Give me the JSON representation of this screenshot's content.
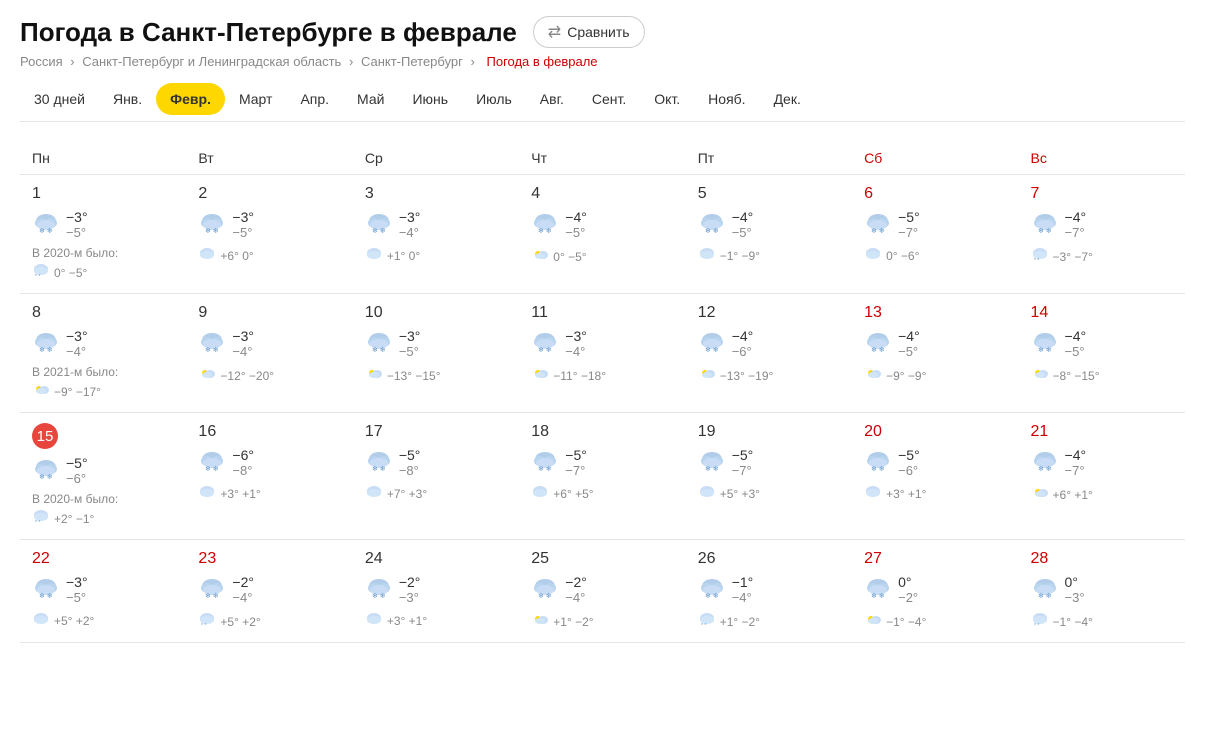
{
  "header": {
    "title": "Погода в Санкт-Петербурге в феврале",
    "compare_label": "Сравнить"
  },
  "breadcrumb": {
    "items": [
      "Россия",
      "Санкт-Петербург и Ленинградская область",
      "Санкт-Петербург"
    ],
    "current": "Погода в феврале"
  },
  "month_tabs": [
    {
      "label": "30 дней",
      "active": false
    },
    {
      "label": "Янв.",
      "active": false
    },
    {
      "label": "Февр.",
      "active": true
    },
    {
      "label": "Март",
      "active": false
    },
    {
      "label": "Апр.",
      "active": false
    },
    {
      "label": "Май",
      "active": false
    },
    {
      "label": "Июнь",
      "active": false
    },
    {
      "label": "Июль",
      "active": false
    },
    {
      "label": "Авг.",
      "active": false
    },
    {
      "label": "Сент.",
      "active": false
    },
    {
      "label": "Окт.",
      "active": false
    },
    {
      "label": "Нояб.",
      "active": false
    },
    {
      "label": "Дек.",
      "active": false
    }
  ],
  "weekdays": [
    {
      "label": "Пн",
      "weekend": false
    },
    {
      "label": "Вт",
      "weekend": false
    },
    {
      "label": "Ср",
      "weekend": false
    },
    {
      "label": "Чт",
      "weekend": false
    },
    {
      "label": "Пт",
      "weekend": false
    },
    {
      "label": "Сб",
      "weekend": true
    },
    {
      "label": "Вс",
      "weekend": true
    }
  ],
  "weeks": [
    {
      "days": [
        {
          "num": "1",
          "weekend": false,
          "today": false,
          "icon": "❄☁",
          "hi": "−3°",
          "lo": "−5°",
          "hist_label": "В 2020-м было:",
          "hist_icon": "☁❄",
          "hist_temps": "0° −5°"
        },
        {
          "num": "2",
          "weekend": false,
          "today": false,
          "icon": "❄☁",
          "hi": "−3°",
          "lo": "−5°",
          "hist_icon": "☁",
          "hist_temps": "+6° 0°"
        },
        {
          "num": "3",
          "weekend": false,
          "today": false,
          "icon": "❄☁",
          "hi": "−3°",
          "lo": "−4°",
          "hist_icon": "☁",
          "hist_temps": "+1° 0°"
        },
        {
          "num": "4",
          "weekend": false,
          "today": false,
          "icon": "❄☁",
          "hi": "−4°",
          "lo": "−5°",
          "hist_icon": "☀☁",
          "hist_temps": "0° −5°"
        },
        {
          "num": "5",
          "weekend": false,
          "today": false,
          "icon": "❄☁",
          "hi": "−4°",
          "lo": "−5°",
          "hist_icon": "☁",
          "hist_temps": "−1° −9°"
        },
        {
          "num": "6",
          "weekend": true,
          "today": false,
          "icon": "❄☁",
          "hi": "−5°",
          "lo": "−7°",
          "hist_icon": "☁",
          "hist_temps": "0° −6°"
        },
        {
          "num": "7",
          "weekend": true,
          "today": false,
          "icon": "❄☁",
          "hi": "−4°",
          "lo": "−7°",
          "hist_icon": "☁❄",
          "hist_temps": "−3° −7°"
        }
      ]
    },
    {
      "days": [
        {
          "num": "8",
          "weekend": false,
          "today": false,
          "icon": "❄☁",
          "hi": "−3°",
          "lo": "−4°",
          "hist_label": "В 2021-м было:",
          "hist_icon": "☀",
          "hist_temps": "−9° −17°"
        },
        {
          "num": "9",
          "weekend": false,
          "today": false,
          "icon": "❄☁",
          "hi": "−3°",
          "lo": "−4°",
          "hist_icon": "☀☁",
          "hist_temps": "−12° −20°"
        },
        {
          "num": "10",
          "weekend": false,
          "today": false,
          "icon": "❄☁",
          "hi": "−3°",
          "lo": "−5°",
          "hist_icon": "☀☁",
          "hist_temps": "−13° −15°"
        },
        {
          "num": "11",
          "weekend": false,
          "today": false,
          "icon": "❄☁",
          "hi": "−3°",
          "lo": "−4°",
          "hist_icon": "☀☁",
          "hist_temps": "−11° −18°"
        },
        {
          "num": "12",
          "weekend": false,
          "today": false,
          "icon": "❄☁",
          "hi": "−4°",
          "lo": "−6°",
          "hist_icon": "☀☁❄",
          "hist_temps": "−13° −19°"
        },
        {
          "num": "13",
          "weekend": true,
          "today": false,
          "icon": "❄☁",
          "hi": "−4°",
          "lo": "−5°",
          "hist_icon": "☀☁",
          "hist_temps": "−9° −9°"
        },
        {
          "num": "14",
          "weekend": true,
          "today": false,
          "icon": "❄☁",
          "hi": "−4°",
          "lo": "−5°",
          "hist_icon": "☀☁",
          "hist_temps": "−8° −15°"
        }
      ]
    },
    {
      "days": [
        {
          "num": "15",
          "weekend": false,
          "today": true,
          "icon": "❄☁",
          "hi": "−5°",
          "lo": "−6°",
          "hist_label": "В 2020-м было:",
          "hist_icon": "☁❄",
          "hist_temps": "+2° −1°"
        },
        {
          "num": "16",
          "weekend": false,
          "today": false,
          "icon": "❄☁",
          "hi": "−6°",
          "lo": "−8°",
          "hist_icon": "☁",
          "hist_temps": "+3° +1°"
        },
        {
          "num": "17",
          "weekend": false,
          "today": false,
          "icon": "❄☁",
          "hi": "−5°",
          "lo": "−8°",
          "hist_icon": "☁",
          "hist_temps": "+7° +3°"
        },
        {
          "num": "18",
          "weekend": false,
          "today": false,
          "icon": "❄☁",
          "hi": "−5°",
          "lo": "−7°",
          "hist_icon": "☁",
          "hist_temps": "+6° +5°"
        },
        {
          "num": "19",
          "weekend": false,
          "today": false,
          "icon": "❄☁",
          "hi": "−5°",
          "lo": "−7°",
          "hist_icon": "☁",
          "hist_temps": "+5° +3°"
        },
        {
          "num": "20",
          "weekend": true,
          "today": false,
          "icon": "❄☁",
          "hi": "−5°",
          "lo": "−6°",
          "hist_icon": "☁",
          "hist_temps": "+3° +1°"
        },
        {
          "num": "21",
          "weekend": true,
          "today": false,
          "icon": "❄☁",
          "hi": "−4°",
          "lo": "−7°",
          "hist_icon": "☀☁",
          "hist_temps": "+6° +1°"
        }
      ]
    },
    {
      "days": [
        {
          "num": "22",
          "weekend": true,
          "today": false,
          "icon": "❄☁",
          "hi": "−3°",
          "lo": "−5°",
          "hist_icon": "☁",
          "hist_temps": "+5° +2°"
        },
        {
          "num": "23",
          "weekend": true,
          "today": false,
          "icon": "❄☁",
          "hi": "−2°",
          "lo": "−4°",
          "hist_icon": "☁❄",
          "hist_temps": "+5° +2°"
        },
        {
          "num": "24",
          "weekend": false,
          "today": false,
          "icon": "❄☁",
          "hi": "−2°",
          "lo": "−3°",
          "hist_icon": "☁",
          "hist_temps": "+3° +1°"
        },
        {
          "num": "25",
          "weekend": false,
          "today": false,
          "icon": "❄☁",
          "hi": "−2°",
          "lo": "−4°",
          "hist_icon": "☀☁",
          "hist_temps": "+1° −2°"
        },
        {
          "num": "26",
          "weekend": false,
          "today": false,
          "icon": "❄☁",
          "hi": "−1°",
          "lo": "−4°",
          "hist_icon": "☁❄",
          "hist_temps": "+1° −2°"
        },
        {
          "num": "27",
          "weekend": true,
          "today": false,
          "icon": "❄☁",
          "hi": "0°",
          "lo": "−2°",
          "hist_icon": "☀",
          "hist_temps": "−1° −4°"
        },
        {
          "num": "28",
          "weekend": true,
          "today": false,
          "icon": "❄☁",
          "hi": "0°",
          "lo": "−3°",
          "hist_icon": "☁❄",
          "hist_temps": "−1° −4°"
        }
      ]
    }
  ]
}
